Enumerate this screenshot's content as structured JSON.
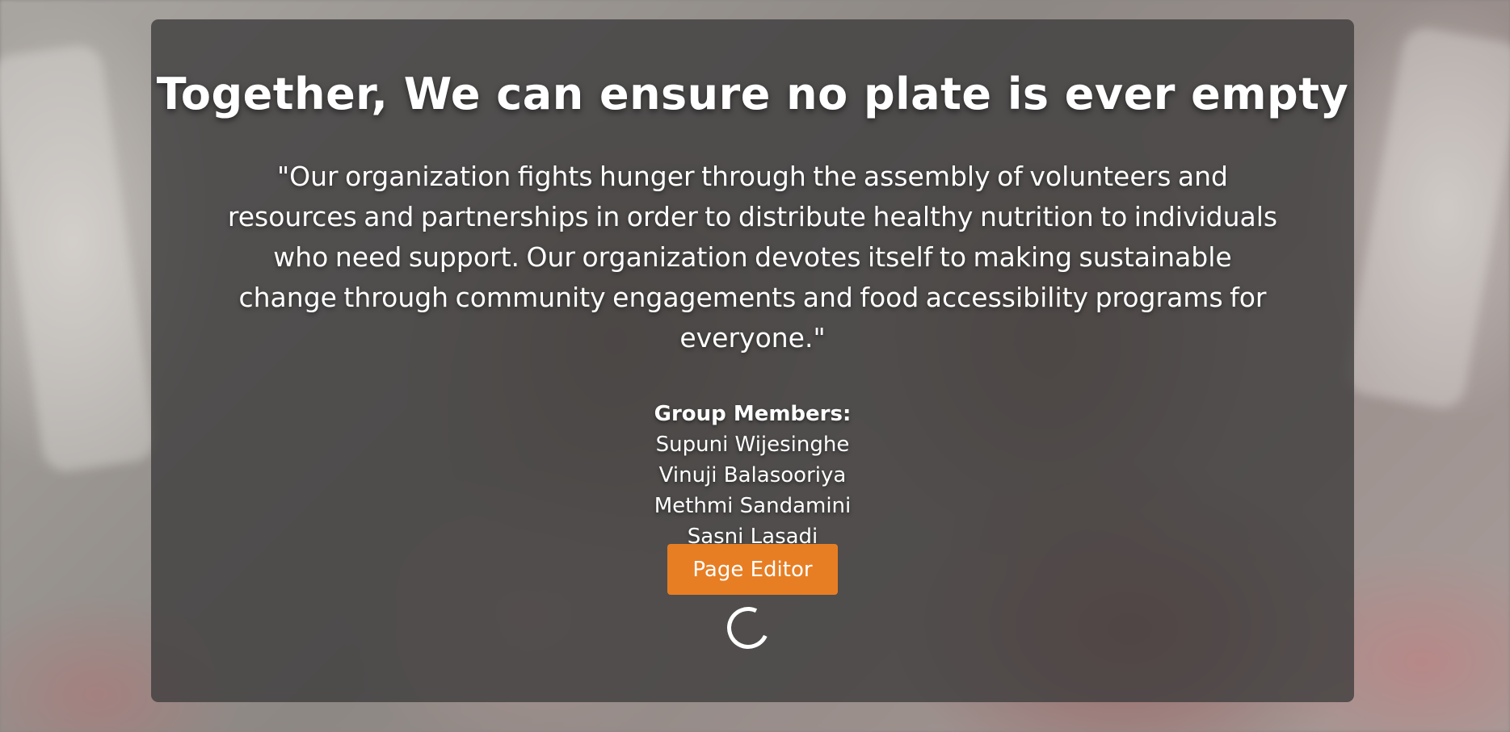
{
  "hero": {
    "title": "Together, We can ensure no plate is ever empty",
    "mission_line_1": "\"Our organization fights hunger through the assembly of volunteers and",
    "mission_line_2": "resources and partnerships in order to distribute healthy nutrition to individuals",
    "mission_line_3": "who need support. Our organization devotes itself to making sustainable",
    "mission_line_4": "change through community engagements and food accessibility programs for",
    "mission_line_5": "everyone.\""
  },
  "members": {
    "heading": "Group Members:",
    "names": [
      "Supuni Wijesinghe",
      "Vinuji Balasooriya",
      "Methmi Sandamini",
      "Sasni Lasadi"
    ]
  },
  "actions": {
    "page_editor_label": "Page Editor"
  },
  "colors": {
    "accent": "#e77e23",
    "overlay": "#3e3d3d",
    "text": "#ffffff"
  },
  "icons": {
    "loading": "loading-spinner-icon"
  }
}
